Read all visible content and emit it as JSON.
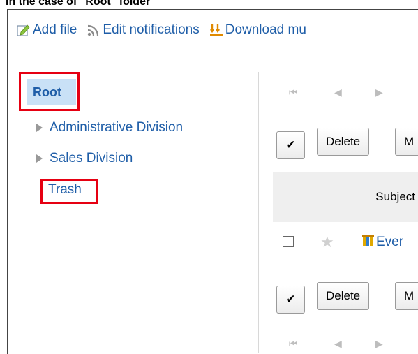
{
  "caption": "In the case of \"Root\" folder",
  "toolbar": {
    "add_file": "Add file",
    "edit_notifications": "Edit notifications",
    "download": "Download mu"
  },
  "tree": {
    "root": "Root",
    "items": [
      "Administrative Division",
      "Sales Division"
    ],
    "trash": "Trash"
  },
  "actions": {
    "check_mark": "✔",
    "delete": "Delete",
    "more": "M"
  },
  "table": {
    "subject_header": "Subject",
    "row_link": "Ever"
  },
  "pager": {
    "first": "⏮",
    "prev": "◀",
    "next": "▶"
  }
}
